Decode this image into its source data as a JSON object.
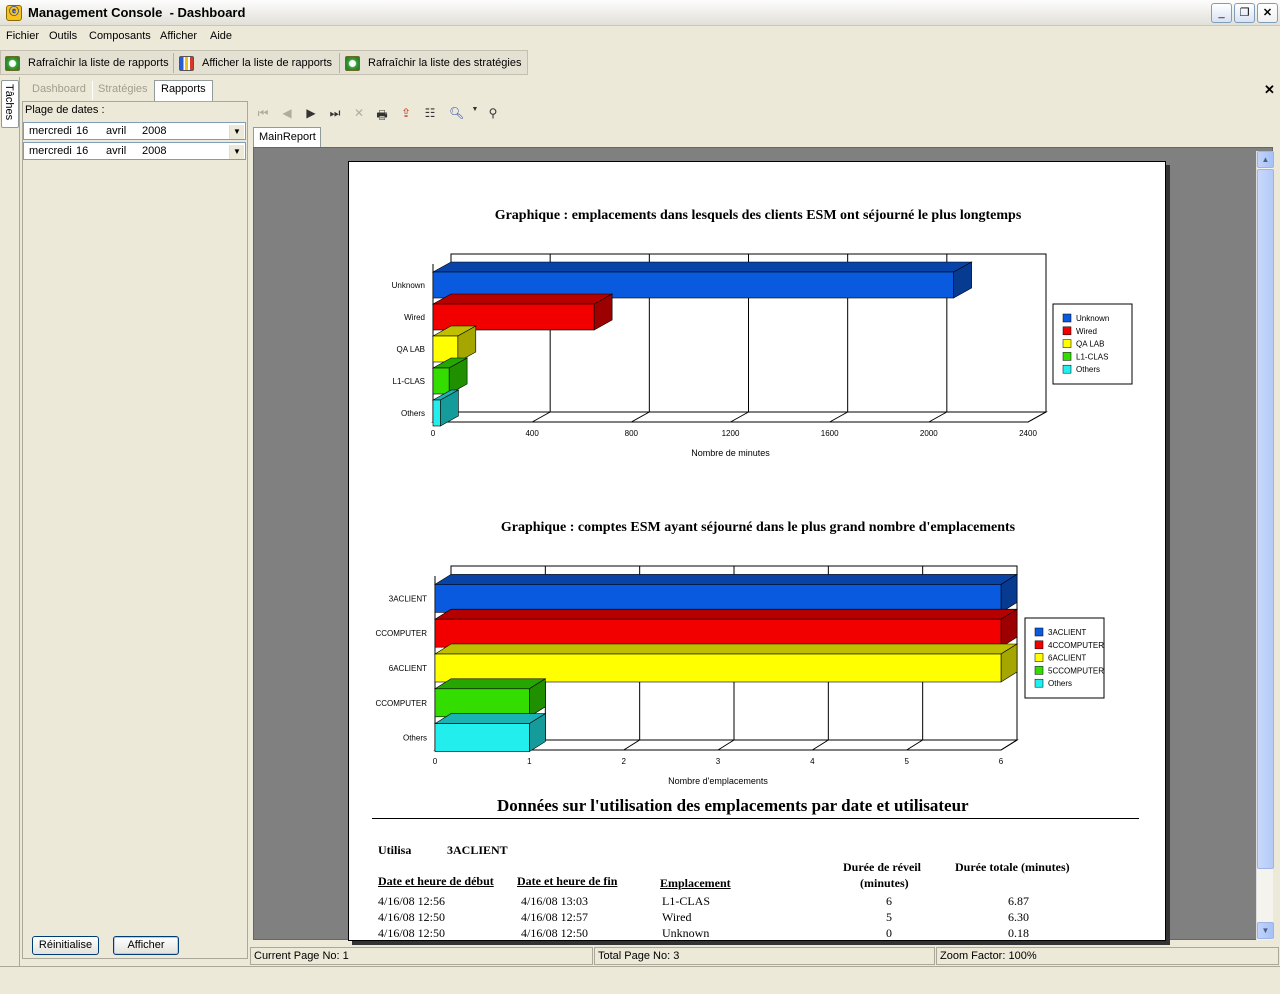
{
  "window": {
    "title": "Management Console  - Dashboard",
    "app_icon": "ⓔ"
  },
  "menu": [
    "Fichier",
    "Outils",
    "Composants",
    "Afficher",
    "Aide"
  ],
  "toolbar": [
    {
      "label": "Rafraîchir la liste de rapports",
      "icon": "refresh-icon"
    },
    {
      "label": "Afficher la liste de rapports",
      "icon": "report-icon"
    },
    {
      "label": "Rafraîchir la liste des stratégies",
      "icon": "refresh-icon"
    }
  ],
  "side_tab": "Tâches",
  "tabs": [
    {
      "label": "Dashboard",
      "active": false
    },
    {
      "label": "Stratégies",
      "active": false
    },
    {
      "label": "Rapports",
      "active": true
    }
  ],
  "left_panel": {
    "label": "Plage de dates :",
    "dates": [
      {
        "day": "mercredi",
        "num": "16",
        "month": "avril",
        "year": "2008"
      },
      {
        "day": "mercredi",
        "num": "16",
        "month": "avril",
        "year": "2008"
      }
    ],
    "reset_button": "Réinitialise",
    "show_button": "Afficher"
  },
  "report_tab": "MainReport",
  "status": {
    "current": "Current Page No: 1",
    "total": "Total Page No: 3",
    "zoom": "Zoom Factor: 100%"
  },
  "chart_data": [
    {
      "type": "bar",
      "orientation": "horizontal",
      "title": "Graphique : emplacements dans lesquels des clients ESM ont séjourné le plus longtemps",
      "xlabel": "Nombre de minutes",
      "ylabel": "",
      "categories": [
        "Unknown",
        "Wired",
        "QA LAB",
        "L1-CLAS",
        "Others"
      ],
      "values": [
        2100,
        650,
        100,
        65,
        30
      ],
      "colors": [
        "#0a5ae0",
        "#f20000",
        "#ffff00",
        "#33dd00",
        "#22eeee"
      ],
      "xlim": [
        0,
        2400
      ],
      "ticks": [
        "0",
        "400",
        "800",
        "1200",
        "1600",
        "2000",
        "2400"
      ],
      "legend": [
        "Unknown",
        "Wired",
        "QA LAB",
        "L1-CLAS",
        "Others"
      ],
      "legend_position": "right",
      "grid": true
    },
    {
      "type": "bar",
      "orientation": "horizontal",
      "title": "Graphique : comptes ESM ayant séjourné dans le plus grand nombre d'emplacements",
      "xlabel": "Nombre d'emplacements",
      "ylabel": "",
      "categories": [
        "3ACLIENT",
        "CCOMPUTER",
        "6ACLIENT",
        "CCOMPUTER",
        "Others"
      ],
      "values": [
        6,
        6,
        6,
        1,
        1
      ],
      "colors": [
        "#0a5ae0",
        "#f20000",
        "#ffff00",
        "#33dd00",
        "#22eeee"
      ],
      "xlim": [
        0,
        6
      ],
      "ticks": [
        "0",
        "1",
        "2",
        "3",
        "4",
        "5",
        "6"
      ],
      "legend": [
        "3ACLIENT",
        "4CCOMPUTER",
        "6ACLIENT",
        "5CCOMPUTER",
        "Others"
      ],
      "legend_position": "right",
      "grid": true
    }
  ],
  "report": {
    "section_title": "Données sur l'utilisation des emplacements par date et utilisateur",
    "user_label": "Utilisa",
    "user_value": "3ACLIENT",
    "columns": [
      "Date et heure de début",
      "Date et heure de fin",
      "Emplacement",
      "Durée de réveil",
      "(minutes)",
      "Durée totale (minutes)"
    ],
    "rows": [
      {
        "start": "4/16/08  12:56",
        "end": "4/16/08  13:03",
        "location": "L1-CLAS",
        "awake": "6",
        "total": "6.87"
      },
      {
        "start": "4/16/08  12:50",
        "end": "4/16/08  12:57",
        "location": "Wired",
        "awake": "5",
        "total": "6.30"
      },
      {
        "start": "4/16/08  12:50",
        "end": "4/16/08  12:50",
        "location": "Unknown",
        "awake": "0",
        "total": "0.18"
      }
    ]
  }
}
